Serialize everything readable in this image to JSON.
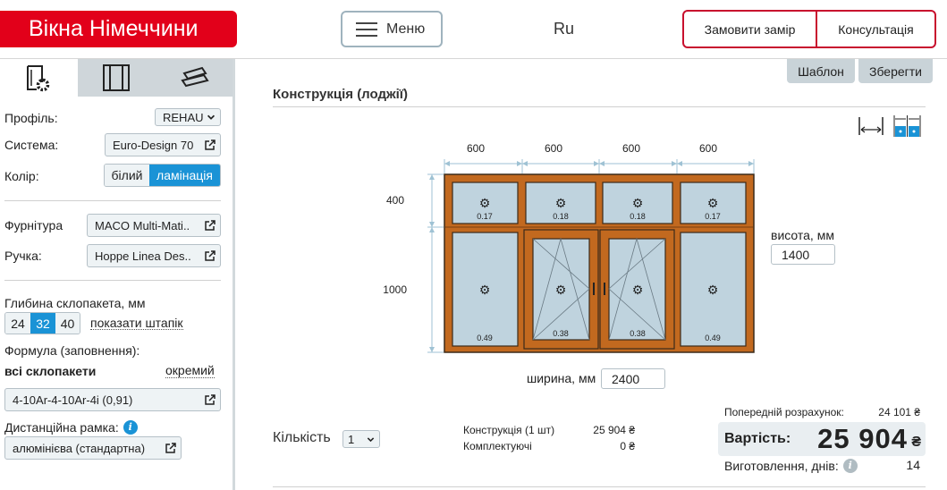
{
  "header": {
    "logo": "Вікна Німеччини",
    "menu_label": "Меню",
    "lang": "Ru",
    "order_measure": "Замовити замір",
    "consultation": "Консультація"
  },
  "sidebar": {
    "profile_label": "Профіль:",
    "profile_value": "REHAU",
    "system_label": "Система:",
    "system_value": "Euro-Design 70",
    "color_label": "Колір:",
    "color_options": [
      "білий",
      "ламінація"
    ],
    "color_selected": "ламінація",
    "hardware_label": "Фурнітура",
    "hardware_value": "MACO Multi-Mati..",
    "handle_label": "Ручка:",
    "handle_value": "Hoppe Linea Des..",
    "depth_label": "Глибина склопакета, мм",
    "depth_options": [
      "24",
      "32",
      "40"
    ],
    "depth_selected": "32",
    "show_bead": "показати штапік",
    "formula_label": "Формула (заповнення):",
    "all_units": "всі склопакети",
    "separate": "окремий",
    "formula_value": "4-10Ar-4-10Ar-4i  (0,91)",
    "spacer_label": "Дистанційна рамка:",
    "spacer_value": "алюмінієва (стандартна)",
    "info_glyph": "i"
  },
  "main": {
    "template_btn": "Шаблон",
    "save_btn": "Зберегти",
    "section_title": "Конструкція (лоджії)",
    "top_widths": [
      "600",
      "600",
      "600",
      "600"
    ],
    "heights": [
      "400",
      "1000"
    ],
    "top_areas": [
      "0.17",
      "0.18",
      "0.18",
      "0.17"
    ],
    "bottom_areas": [
      "0.49",
      "0.38",
      "0.38",
      "0.49"
    ],
    "height_label": "висота, мм",
    "height_value": "1400",
    "width_label": "ширина, мм",
    "width_value": "2400",
    "qty_label": "Кількість",
    "qty_value": "1",
    "construction_label": "Конструкція (1 шт)",
    "construction_price": "25 904 ₴",
    "accessories_label": "Комплектуючі",
    "accessories_price": "0 ₴",
    "prev_calc_label": "Попередній розрахунок:",
    "prev_calc_value": "24 101 ₴",
    "cost_label": "Вартість:",
    "cost_value": "25 904",
    "currency": "₴",
    "production_label": "Виготовлення, днів:",
    "production_days": "14"
  },
  "colors": {
    "brand_red": "#e2001a",
    "accent_blue": "#1a93d6",
    "frame_wood": "#c2691f",
    "glass": "#bfd3de"
  }
}
